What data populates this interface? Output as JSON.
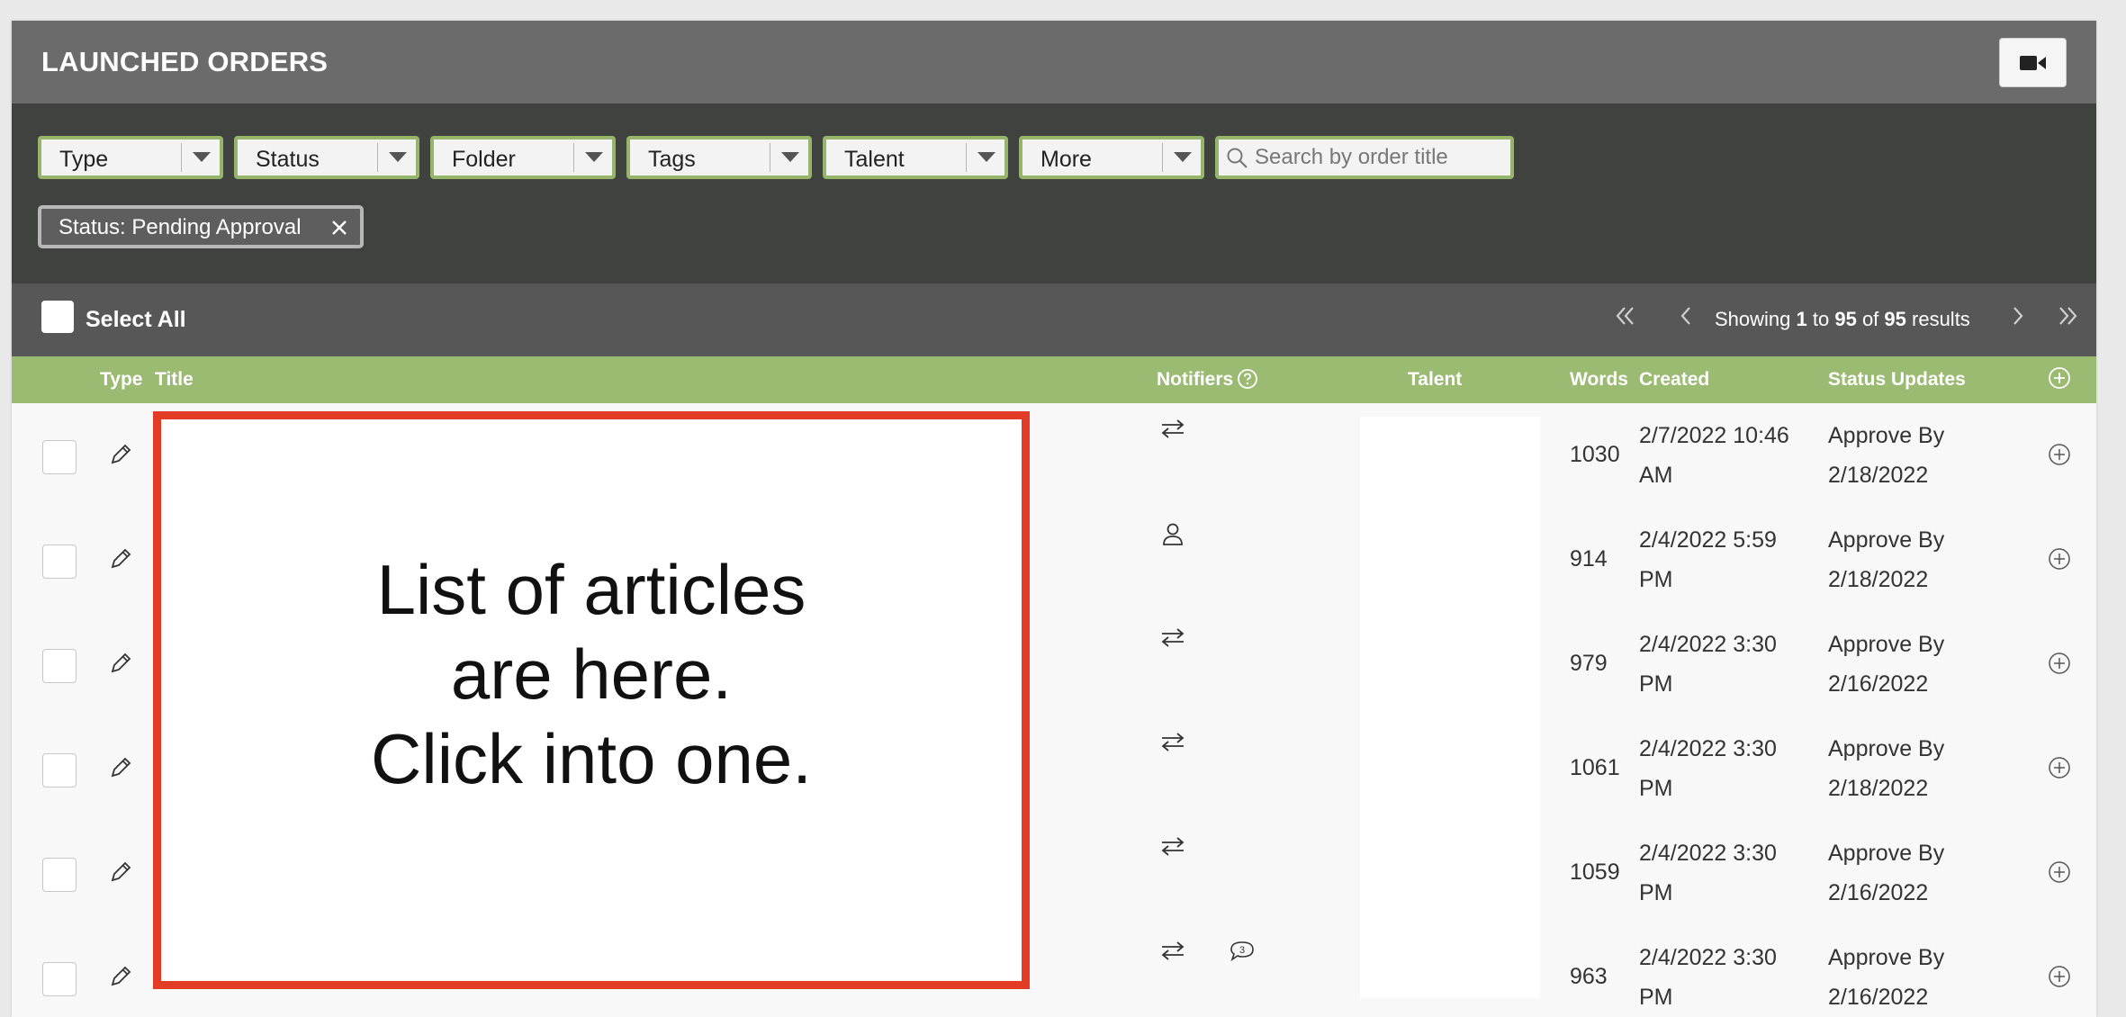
{
  "header": {
    "title": "LAUNCHED ORDERS",
    "video_icon": "video-camera-icon"
  },
  "filters": [
    {
      "label": "Type"
    },
    {
      "label": "Status"
    },
    {
      "label": "Folder"
    },
    {
      "label": "Tags"
    },
    {
      "label": "Talent"
    },
    {
      "label": "More"
    }
  ],
  "search": {
    "placeholder": "Search by order title",
    "icon": "search-icon"
  },
  "active_filter": {
    "label": "Status: Pending Approval"
  },
  "selection": {
    "label": "Select All"
  },
  "pagination": {
    "prefix": "Showing ",
    "from": "1",
    "to_word": " to ",
    "to": "95",
    "of_word": " of ",
    "total": "95",
    "suffix": " results"
  },
  "columns": {
    "type": "Type",
    "title": "Title",
    "notifiers": "Notifiers",
    "talent": "Talent",
    "words": "Words",
    "created": "Created",
    "status_updates": "Status Updates"
  },
  "rows": [
    {
      "notifier": "transfer-icon",
      "words": "1030",
      "created_1": "2/7/2022 10:46",
      "created_2": "AM",
      "status_1": "Approve By",
      "status_2": "2/18/2022"
    },
    {
      "notifier": "person-icon",
      "words": "914",
      "created_1": "2/4/2022 5:59",
      "created_2": "PM",
      "status_1": "Approve By",
      "status_2": "2/18/2022"
    },
    {
      "notifier": "transfer-icon",
      "words": "979",
      "created_1": "2/4/2022 3:30",
      "created_2": "PM",
      "status_1": "Approve By",
      "status_2": "2/16/2022"
    },
    {
      "notifier": "transfer-icon",
      "words": "1061",
      "created_1": "2/4/2022 3:30",
      "created_2": "PM",
      "status_1": "Approve By",
      "status_2": "2/18/2022"
    },
    {
      "notifier": "transfer-icon",
      "words": "1059",
      "created_1": "2/4/2022 3:30",
      "created_2": "PM",
      "status_1": "Approve By",
      "status_2": "2/16/2022"
    },
    {
      "notifier": "transfer-icon",
      "comment_count": "3",
      "words": "963",
      "created_1": "2/4/2022 3:30",
      "created_2": "PM",
      "status_1": "Approve By",
      "status_2": "2/16/2022"
    }
  ],
  "annotation": {
    "text": "List of articles are here. Click into one."
  },
  "colors": {
    "header": "#6b6b6b",
    "filterbar": "#404240",
    "accent_green": "#9bba72",
    "annotation_border": "#e23b26"
  }
}
